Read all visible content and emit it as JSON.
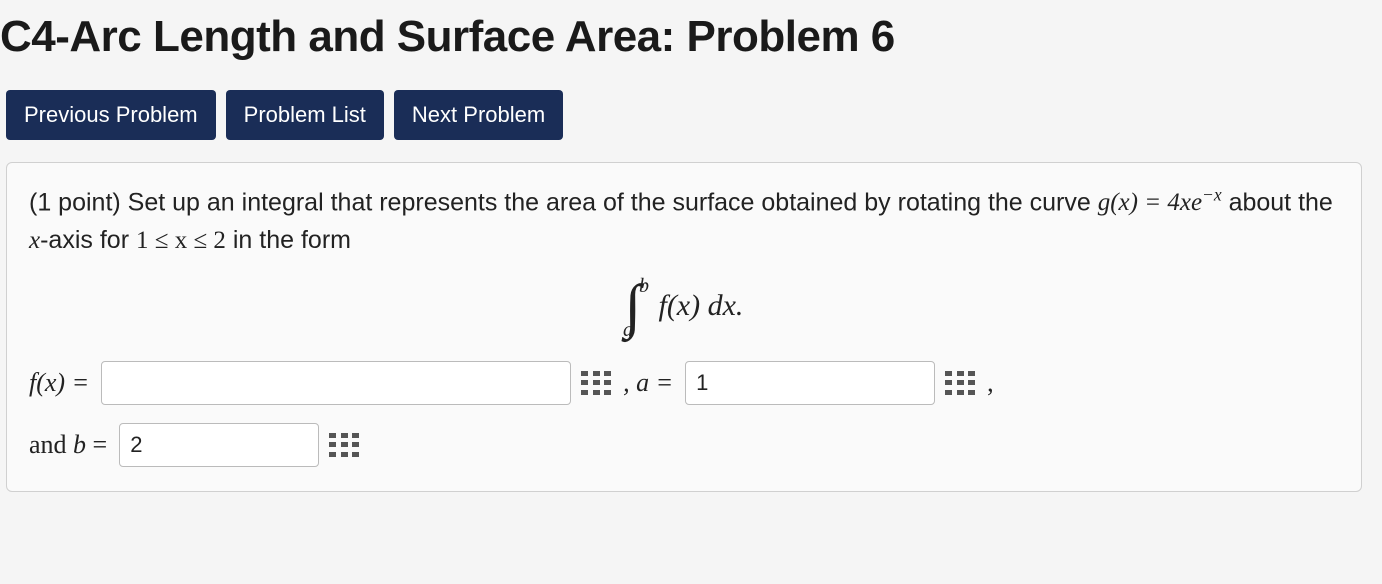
{
  "title": "C4-Arc Length and Surface Area: Problem 6",
  "nav": {
    "prev": "Previous Problem",
    "list": "Problem List",
    "next": "Next Problem"
  },
  "problem": {
    "points_prefix": "(1 point) ",
    "text_1": "Set up an integral that represents the area of the surface obtained by rotating the curve ",
    "gx_label": "g(x) = 4xe",
    "gx_exp": "−x",
    "text_2": " about the ",
    "axis": "x",
    "text_3": "-axis for ",
    "range": "1 ≤ x ≤ 2",
    "text_4": " in the form",
    "integral": {
      "lower": "a",
      "upper": "b",
      "body": "f(x) dx."
    }
  },
  "answers": {
    "fx_label": "f(x) =",
    "fx_value": "",
    "a_label": ", a =",
    "a_value": "1",
    "comma": ",",
    "b_label": "and b =",
    "b_value": "2"
  }
}
